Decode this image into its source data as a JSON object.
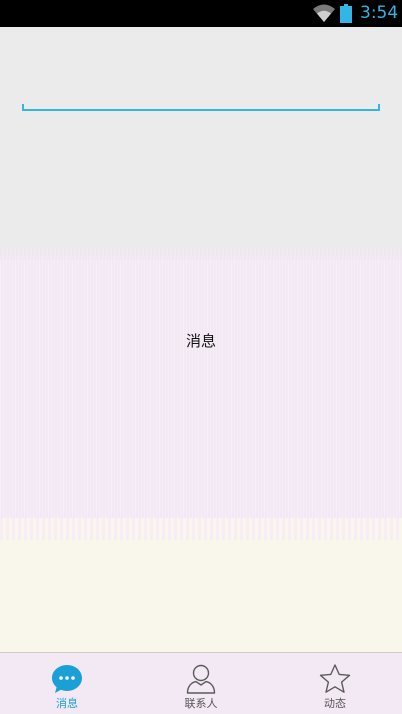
{
  "status_bar": {
    "time": "3:54",
    "icons": [
      "wifi-icon",
      "battery-icon"
    ],
    "clock_color": "#33b5e5"
  },
  "search": {
    "value": "",
    "placeholder": ""
  },
  "content": {
    "title": "消息"
  },
  "tabs": [
    {
      "label": "消息",
      "icon": "chat-bubble-icon",
      "active": true
    },
    {
      "label": "联系人",
      "icon": "person-icon",
      "active": false
    },
    {
      "label": "动态",
      "icon": "star-icon",
      "active": false
    }
  ],
  "colors": {
    "accent": "#1aa0d6",
    "top_background": "#ebebeb",
    "middle_background": "#f3e9f4",
    "bottom_background": "#f9f6ec"
  }
}
